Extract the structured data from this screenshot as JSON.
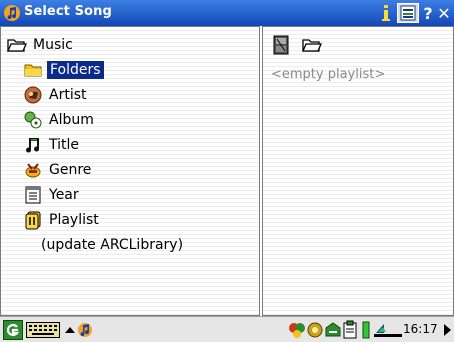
{
  "window": {
    "title": "Select Song"
  },
  "tree": {
    "root": "Music",
    "items": [
      {
        "label": "Folders",
        "icon": "folder-icon",
        "selected": true
      },
      {
        "label": "Artist",
        "icon": "artist-icon"
      },
      {
        "label": "Album",
        "icon": "album-icon"
      },
      {
        "label": "Title",
        "icon": "music-note-icon"
      },
      {
        "label": "Genre",
        "icon": "genre-icon"
      },
      {
        "label": "Year",
        "icon": "calendar-icon"
      },
      {
        "label": "Playlist",
        "icon": "playlist-icon"
      },
      {
        "label": "(update ARCLibrary)",
        "icon": ""
      }
    ]
  },
  "playlist": {
    "empty_text": "<empty playlist>"
  },
  "statusbar": {
    "time": "16:17"
  },
  "colors": {
    "titlebar": "#1347b6",
    "selection": "#0b2a8a",
    "muted_text": "#8a8a8a"
  }
}
